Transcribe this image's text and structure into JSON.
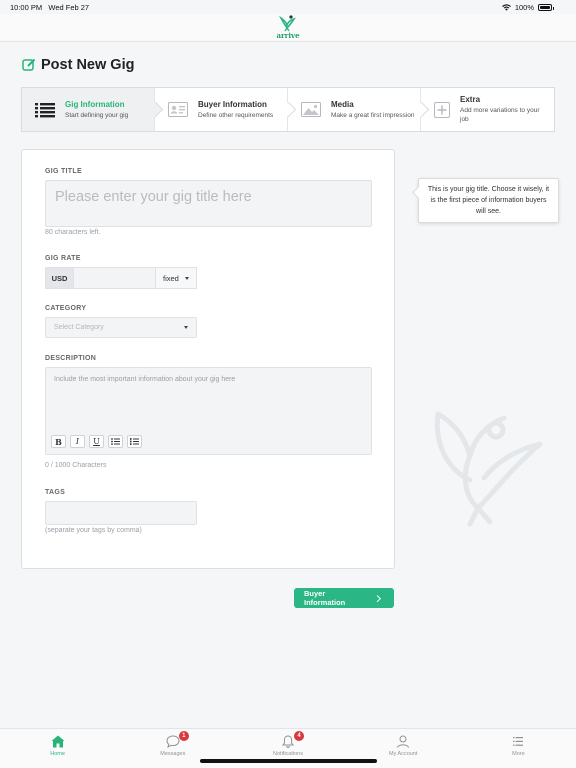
{
  "status_bar": {
    "time": "10:00 PM",
    "date": "Wed Feb 27",
    "battery": "100%"
  },
  "header": {
    "logo_text": "arrive"
  },
  "page": {
    "title": "Post New Gig"
  },
  "steps": [
    {
      "title": "Gig Information",
      "desc": "Start defining your gig",
      "icon": "list-icon"
    },
    {
      "title": "Buyer Information",
      "desc": "Define other requirements",
      "icon": "id-card-icon"
    },
    {
      "title": "Media",
      "desc": "Make a great first impression",
      "icon": "image-icon"
    },
    {
      "title": "Extra",
      "desc": "Add more variations to your job",
      "icon": "plus-box-icon"
    }
  ],
  "form": {
    "gig_title_label": "GIG TITLE",
    "gig_title_placeholder": "Please enter your gig title here",
    "chars_left": "80 characters left.",
    "gig_rate_label": "GIG RATE",
    "currency": "USD",
    "rate_type": "fixed",
    "category_label": "CATEGORY",
    "category_placeholder": "Select Category",
    "description_label": "DESCRIPTION",
    "description_placeholder": "Include the most important information about your gig here",
    "toolbar": [
      "B",
      "I",
      "U"
    ],
    "description_count": "0 / 1000 Characters",
    "tags_label": "TAGS",
    "tags_hint": "(separate your tags by comma)"
  },
  "tooltip": {
    "text": "This is your gig title. Choose it wisely, it is the first piece of information buyers will see."
  },
  "next_button": {
    "label": "Buyer Information"
  },
  "tabbar": [
    {
      "label": "Home",
      "active": true,
      "badge": ""
    },
    {
      "label": "Messages",
      "active": false,
      "badge": "1"
    },
    {
      "label": "Notifications",
      "active": false,
      "badge": "4"
    },
    {
      "label": "My Account",
      "active": false,
      "badge": ""
    },
    {
      "label": "More",
      "active": false,
      "badge": ""
    }
  ],
  "colors": {
    "accent": "#27b47b",
    "button": "#2bb686",
    "badge": "#d9363e"
  }
}
